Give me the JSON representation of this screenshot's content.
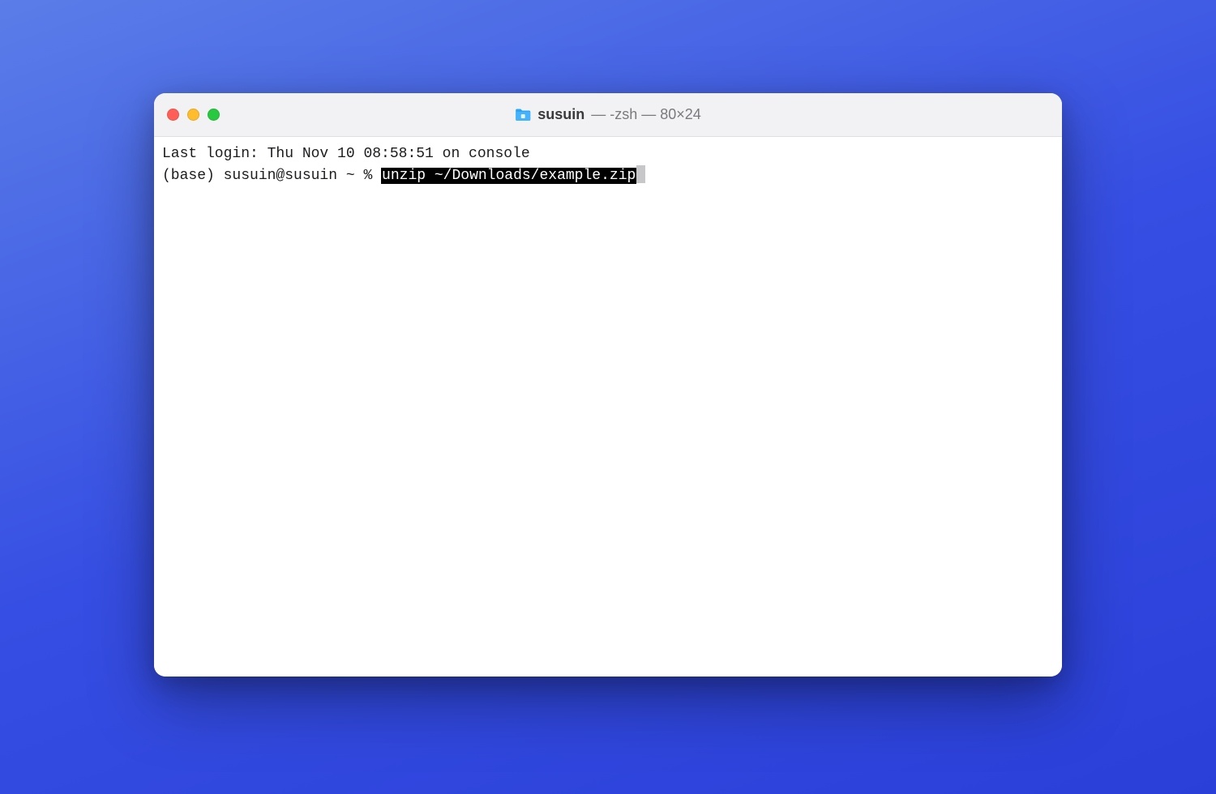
{
  "window": {
    "title_folder": "susuin",
    "title_suffix": " — -zsh — 80×24"
  },
  "terminal": {
    "last_login": "Last login: Thu Nov 10 08:58:51 on console",
    "prompt": "(base) susuin@susuin ~ % ",
    "command": "unzip ~/Downloads/example.zip"
  },
  "traffic_lights": {
    "close": "close",
    "minimize": "minimize",
    "zoom": "zoom"
  }
}
